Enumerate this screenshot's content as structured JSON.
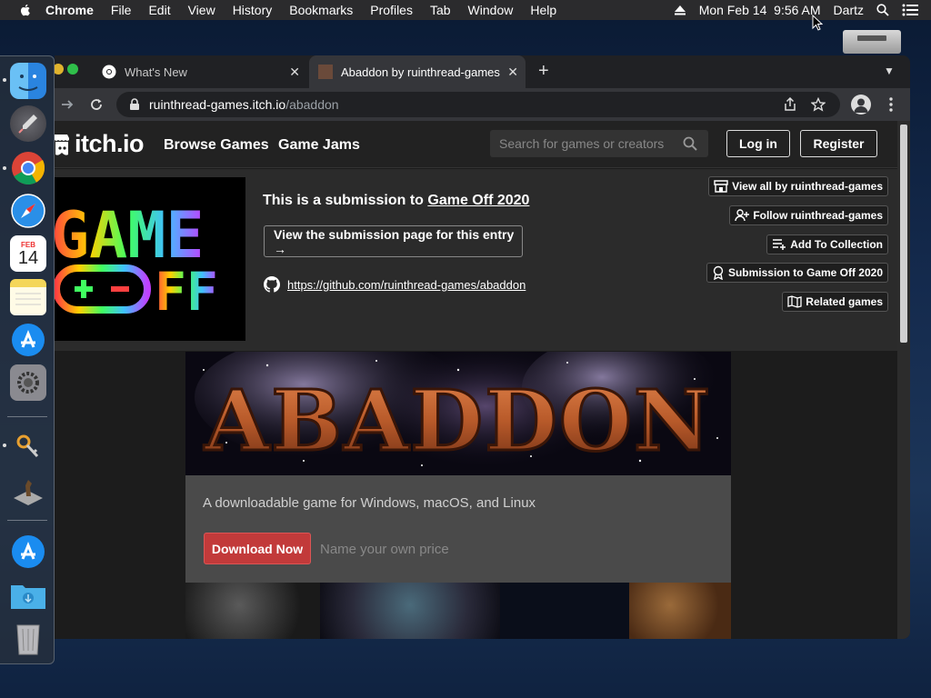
{
  "menubar": {
    "app": "Chrome",
    "items": [
      "File",
      "Edit",
      "View",
      "History",
      "Bookmarks",
      "Profiles",
      "Tab",
      "Window",
      "Help"
    ],
    "datetime": "Mon Feb 14  9:56 AM",
    "user": "Dartz"
  },
  "dock": {
    "apps": [
      "finder-icon",
      "launchpad-icon",
      "chrome-icon",
      "safari-icon",
      "calendar-icon",
      "notes-icon",
      "app-store-icon",
      "system-preferences-icon",
      "keychain-icon",
      "chess-icon",
      "app-store-icon",
      "downloads-folder-icon",
      "trash-icon"
    ],
    "calendar": {
      "month": "FEB",
      "day": "14"
    }
  },
  "browser": {
    "tabs": [
      {
        "title": "What's New",
        "active": false
      },
      {
        "title": "Abaddon by ruinthread-games",
        "active": true
      }
    ],
    "url_host": "ruinthread-games.itch.io",
    "url_path": "/abaddon"
  },
  "itch": {
    "logo": "itch.io",
    "nav": [
      "Browse Games",
      "Game Jams"
    ],
    "search_placeholder": "Search for games or creators",
    "login": "Log in",
    "register": "Register"
  },
  "jam": {
    "logo_line1": "GAME",
    "logo_line2": "FF",
    "submission_prefix": "This is a submission to ",
    "jam_name": "Game Off 2020",
    "view_submission": "View the submission page for this entry →",
    "github_url": "https://github.com/ruinthread-games/abaddon"
  },
  "side_buttons": [
    {
      "label": "View all by ruinthread-games",
      "icon": "store-icon"
    },
    {
      "label": "Follow ruinthread-games",
      "icon": "follow-user-icon"
    },
    {
      "label": "Add To Collection",
      "icon": "add-to-list-icon"
    },
    {
      "label": "Submission to Game Off 2020",
      "icon": "award-icon"
    },
    {
      "label": "Related games",
      "icon": "map-icon"
    }
  ],
  "game": {
    "title_art": "ABADDON",
    "tagline": "A downloadable game for Windows, macOS, and Linux",
    "download": "Download Now",
    "price_text": "Name your own price"
  },
  "colors": {
    "download_button": "#c23a3a",
    "itch_header": "#222222",
    "jam_bar": "#2b2b2b"
  }
}
